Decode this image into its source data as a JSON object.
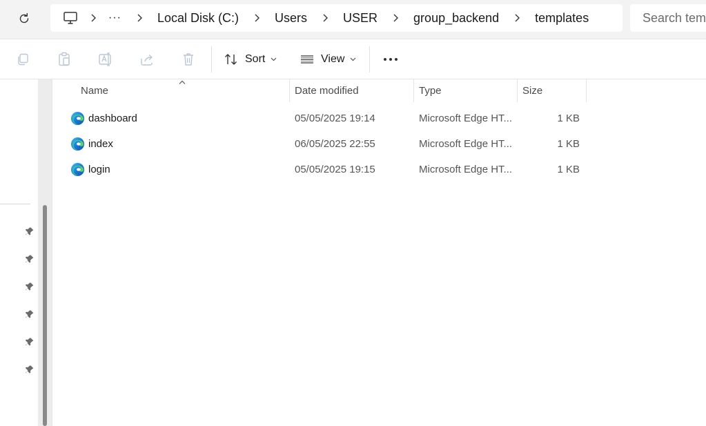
{
  "address_bar": {
    "breadcrumb": [
      "Local Disk (C:)",
      "Users",
      "USER",
      "group_backend",
      "templates"
    ],
    "overflow_glyph": "···",
    "search_placeholder": "Search templates"
  },
  "command_bar": {
    "sort_label": "Sort",
    "view_label": "View",
    "more_glyph": "•••"
  },
  "file_list": {
    "columns": {
      "name": "Name",
      "date": "Date modified",
      "type": "Type",
      "size": "Size"
    },
    "files": [
      {
        "name": "dashboard",
        "date": "05/05/2025 19:14",
        "type": "Microsoft Edge HT...",
        "size": "1 KB"
      },
      {
        "name": "index",
        "date": "06/05/2025 22:55",
        "type": "Microsoft Edge HT...",
        "size": "1 KB"
      },
      {
        "name": "login",
        "date": "05/05/2025 19:15",
        "type": "Microsoft Edge HT...",
        "size": "1 KB"
      }
    ]
  },
  "icons": {
    "refresh": "refresh-icon",
    "computer": "computer-icon",
    "chevron": "chevron-right-icon",
    "copy": "copy-icon",
    "paste": "paste-icon",
    "rename": "rename-icon",
    "share": "share-icon",
    "delete": "trash-icon",
    "sort": "sort-arrows-icon",
    "view": "view-lines-icon",
    "pin": "pin-icon",
    "file": "edge-html-file-icon"
  },
  "colors": {
    "accent": "#0067c0",
    "edge_teal": "#2bc4a8",
    "edge_blue": "#1a73d9"
  }
}
